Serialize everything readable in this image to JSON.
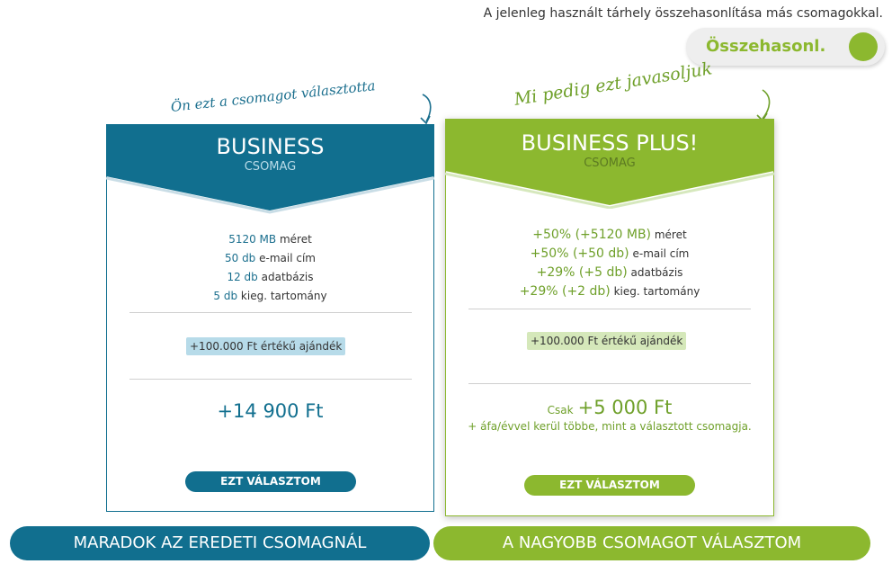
{
  "header": {
    "compare_note": "A jelenleg használt tárhely összehasonlítása más csomagokkal.",
    "compare_toggle_label": "Összehasonl."
  },
  "annotations": {
    "current_choice": "Ön ezt a csomagot választotta",
    "recommended": "Mi pedig ezt javasoljuk"
  },
  "current_plan": {
    "title": "BUSINESS",
    "subtitle": "CSOMAG",
    "features": [
      {
        "value": "5120 MB",
        "label": "méret"
      },
      {
        "value": "50 db",
        "label": "e-mail cím"
      },
      {
        "value": "12 db",
        "label": "adatbázis"
      },
      {
        "value": "5 db",
        "label": "kieg. tartomány"
      }
    ],
    "gift": "+100.000 Ft értékű ajándék",
    "price": "+14 900 Ft",
    "select_label": "EZT VÁLASZTOM"
  },
  "recommended_plan": {
    "title": "BUSINESS PLUS!",
    "subtitle": "CSOMAG",
    "features": [
      {
        "value": "+50% (+5120 MB)",
        "label": "méret"
      },
      {
        "value": "+50% (+50 db)",
        "label": "e-mail cím"
      },
      {
        "value": "+29% (+5 db)",
        "label": "adatbázis"
      },
      {
        "value": "+29% (+2 db)",
        "label": "kieg. tartomány"
      }
    ],
    "gift": "+100.000 Ft értékű ajándék",
    "price_prefix": "Csak",
    "price": "+5 000 Ft",
    "price_note": "+ áfa/évvel kerül többe, mint a választott csomagja.",
    "select_label": "EZT VÁLASZTOM"
  },
  "footer": {
    "stay_label": "MARADOK AZ EREDETI CSOMAGNÁL",
    "upgrade_label": "A NAGYOBB CSOMAGOT VÁLASZTOM"
  },
  "colors": {
    "primary_blue": "#116f8f",
    "primary_green": "#8cb82f",
    "gift_blue": "#b7dbe9",
    "gift_green": "#d5e8ba"
  }
}
